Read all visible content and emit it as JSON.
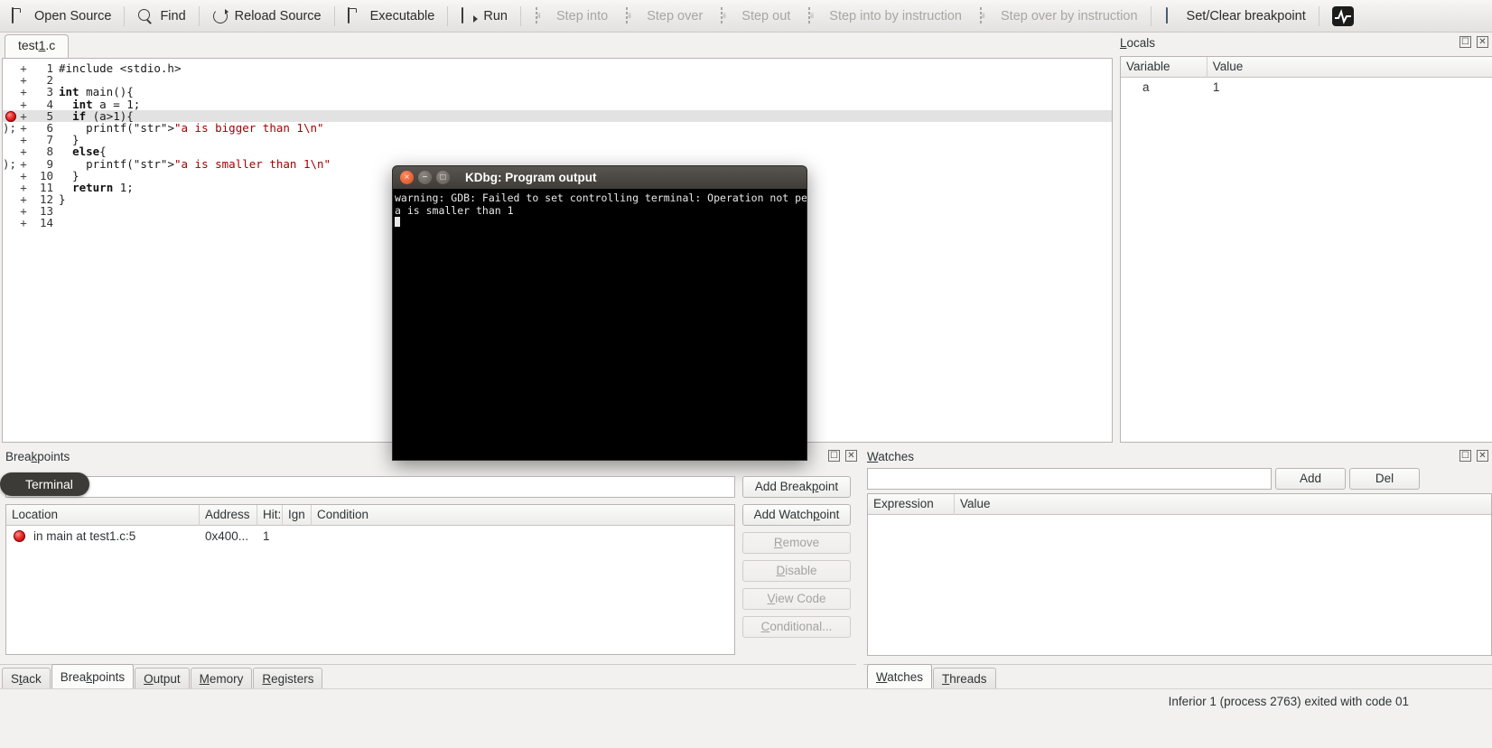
{
  "toolbar": {
    "items": [
      {
        "label": "Open Source",
        "icon": "folder-icon",
        "enabled": true
      },
      {
        "label": "Find",
        "icon": "search-icon",
        "enabled": true
      },
      {
        "label": "Reload Source",
        "icon": "reload-icon",
        "enabled": true
      },
      {
        "label": "Executable",
        "icon": "folder-icon",
        "enabled": true
      },
      {
        "label": "Run",
        "icon": "run-icon",
        "enabled": true
      },
      {
        "label": "Step into",
        "icon": "step-into-icon",
        "enabled": false
      },
      {
        "label": "Step over",
        "icon": "step-over-icon",
        "enabled": false
      },
      {
        "label": "Step out",
        "icon": "step-out-icon",
        "enabled": false
      },
      {
        "label": "Step into by instruction",
        "icon": "step-into-instruction-icon",
        "enabled": false
      },
      {
        "label": "Step over by instruction",
        "icon": "step-over-instruction-icon",
        "enabled": false
      },
      {
        "label": "Set/Clear breakpoint",
        "icon": "breakpoint-page-icon",
        "enabled": true
      },
      {
        "label": "",
        "icon": "pulse-icon",
        "enabled": true
      }
    ]
  },
  "source": {
    "tab_label": "test1.c",
    "current_line": 5,
    "breakpoint_line": 5,
    "lines": [
      {
        "num": "1",
        "text": "#include <stdio.h>"
      },
      {
        "num": "2",
        "text": ""
      },
      {
        "num": "3",
        "text": "int main(){"
      },
      {
        "num": "4",
        "text": "  int a = 1;"
      },
      {
        "num": "5",
        "text": "  if (a>1){"
      },
      {
        "num": "6",
        "text": "    printf(\"a is bigger than 1\\n\");"
      },
      {
        "num": "7",
        "text": "  }"
      },
      {
        "num": "8",
        "text": "  else{"
      },
      {
        "num": "9",
        "text": "    printf(\"a is smaller than 1\\n\");"
      },
      {
        "num": "10",
        "text": "  }"
      },
      {
        "num": "11",
        "text": "  return 1;"
      },
      {
        "num": "12",
        "text": "}"
      },
      {
        "num": "13",
        "text": ""
      },
      {
        "num": "14",
        "text": ""
      }
    ]
  },
  "locals": {
    "title": "Locals",
    "title_mnemonic": "L",
    "columns": [
      "Variable",
      "Value"
    ],
    "rows": [
      {
        "variable": "a",
        "value": "1"
      }
    ],
    "float_button": "float-icon",
    "close_button": "close-icon"
  },
  "terminal_window": {
    "title": "KDbg: Program output",
    "buttons": {
      "close": "×",
      "minimize": "−",
      "maximize": "□"
    },
    "lines": [
      "warning: GDB: Failed to set controlling terminal: Operation not permitted",
      "a is smaller than 1"
    ]
  },
  "breakpoints": {
    "title": "Breakpoints",
    "title_mnemonic": "k",
    "input_value": "",
    "tooltip": "Terminal",
    "columns": [
      "Location",
      "Address",
      "Hit:",
      "Ign",
      "Condition"
    ],
    "rows": [
      {
        "location": "in main at test1.c:5",
        "address": "0x400...",
        "hits": "1",
        "ign": "",
        "condition": ""
      }
    ],
    "buttons": [
      {
        "label": "Add Breakpoint",
        "enabled": true
      },
      {
        "label": "Add Watchpoint",
        "enabled": true
      },
      {
        "label": "Remove",
        "enabled": false
      },
      {
        "label": "Disable",
        "enabled": false
      },
      {
        "label": "View Code",
        "enabled": false
      },
      {
        "label": "Conditional...",
        "enabled": false
      }
    ]
  },
  "watches": {
    "title": "Watches",
    "input_value": "",
    "add_label": "Add",
    "del_label": "Del",
    "columns": [
      "Expression",
      "Value"
    ],
    "rows": []
  },
  "bottom_tabs_left": [
    {
      "label": "Stack",
      "active": false
    },
    {
      "label": "Breakpoints",
      "active": true
    },
    {
      "label": "Output",
      "active": false
    },
    {
      "label": "Memory",
      "active": false
    },
    {
      "label": "Registers",
      "active": false
    }
  ],
  "bottom_tabs_right": [
    {
      "label": "Watches",
      "active": true
    },
    {
      "label": "Threads",
      "active": false
    }
  ],
  "statusbar": {
    "message": "Inferior 1 (process 2763) exited with code 01"
  },
  "colors": {
    "accent_red": "#a40000",
    "breakpoint": "#ea2b2b",
    "window_bg": "#f2f1f0",
    "terminal_bg": "#000000"
  }
}
